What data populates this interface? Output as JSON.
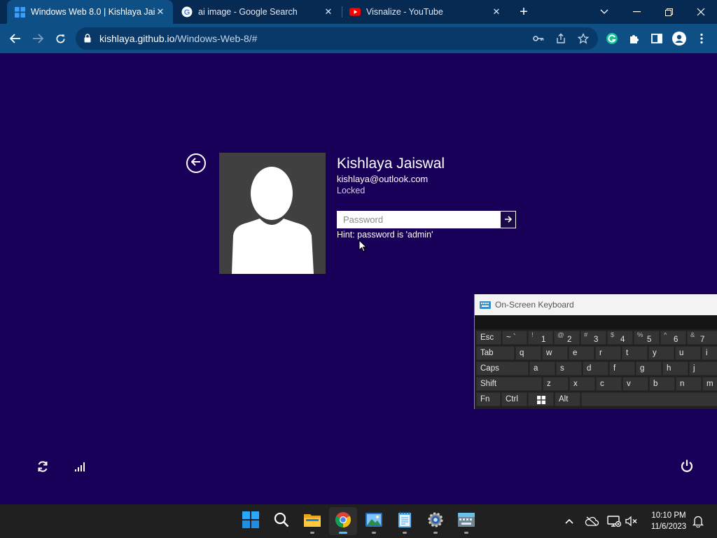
{
  "browser": {
    "tabs": [
      {
        "title": "Windows Web 8.0 | Kishlaya Jaiswal",
        "icon": "windows-logo-icon",
        "active": true
      },
      {
        "title": "ai image - Google Search",
        "icon": "google-icon",
        "active": false
      },
      {
        "title": "Visnalize - YouTube",
        "icon": "youtube-icon",
        "active": false
      }
    ],
    "new_tab": "+",
    "address": {
      "host": "kishlaya.github.io",
      "path": "/Windows-Web-8/#"
    }
  },
  "lockscreen": {
    "user_name": "Kishlaya Jaiswal",
    "user_email": "kishlaya@outlook.com",
    "status": "Locked",
    "password_placeholder": "Password",
    "hint": "Hint: password is 'admin'"
  },
  "osk": {
    "title": "On-Screen Keyboard",
    "rows": [
      [
        {
          "label": "Esc"
        },
        {
          "label": "~ `"
        },
        {
          "shift": "!",
          "main": "1"
        },
        {
          "shift": "@",
          "main": "2"
        },
        {
          "shift": "#",
          "main": "3"
        },
        {
          "shift": "$",
          "main": "4"
        },
        {
          "shift": "%",
          "main": "5"
        },
        {
          "shift": "^",
          "main": "6"
        },
        {
          "shift": "&",
          "main": "7"
        }
      ],
      [
        {
          "label": "Tab"
        },
        {
          "label": "q"
        },
        {
          "label": "w"
        },
        {
          "label": "e"
        },
        {
          "label": "r"
        },
        {
          "label": "t"
        },
        {
          "label": "y"
        },
        {
          "label": "u"
        },
        {
          "label": "i"
        }
      ],
      [
        {
          "label": "Caps"
        },
        {
          "label": "a"
        },
        {
          "label": "s"
        },
        {
          "label": "d"
        },
        {
          "label": "f"
        },
        {
          "label": "g"
        },
        {
          "label": "h"
        },
        {
          "label": "j"
        }
      ],
      [
        {
          "label": "Shift"
        },
        {
          "label": "z"
        },
        {
          "label": "x"
        },
        {
          "label": "c"
        },
        {
          "label": "v"
        },
        {
          "label": "b"
        },
        {
          "label": "n"
        },
        {
          "label": "m"
        }
      ],
      [
        {
          "label": "Fn"
        },
        {
          "label": "Ctrl"
        },
        {
          "label": ""
        },
        {
          "label": "Alt"
        },
        {
          "label": ""
        }
      ]
    ]
  },
  "taskbar": {
    "apps": [
      "start-icon",
      "search-icon",
      "file-explorer-icon",
      "chrome-icon",
      "photos-icon",
      "notepad-icon",
      "settings-icon",
      "on-screen-keyboard-icon"
    ],
    "time": "10:10 PM",
    "date": "11/6/2023"
  },
  "colors": {
    "lockscreen_bg": "#180059",
    "browser_frame": "#062a52",
    "browser_toolbar": "#0e4f86",
    "taskbar": "#202020"
  }
}
